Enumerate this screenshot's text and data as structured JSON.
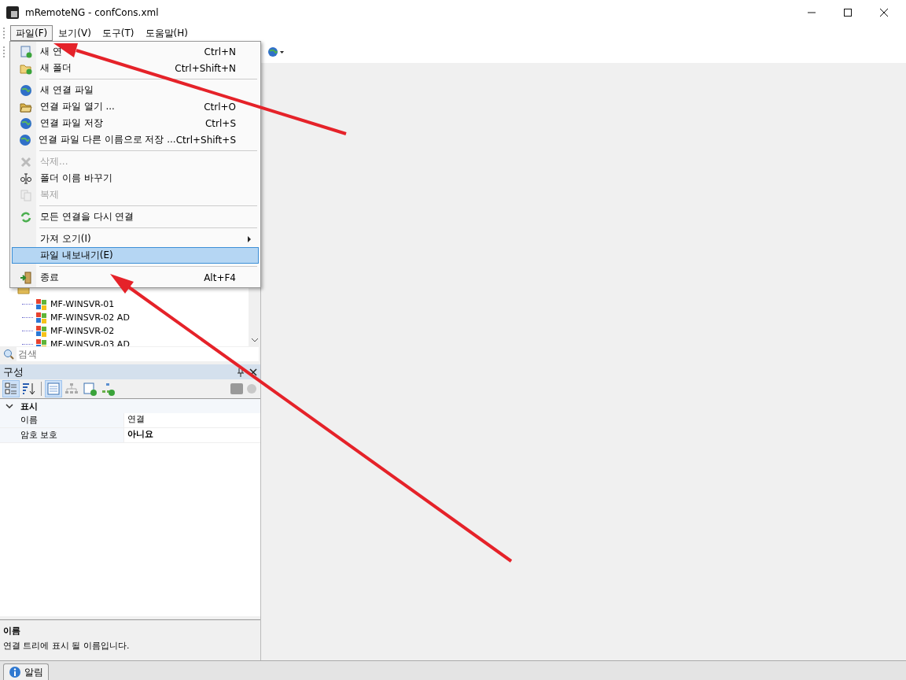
{
  "window": {
    "title": "mRemoteNG - confCons.xml"
  },
  "menubar": [
    {
      "label": "파일(F)",
      "selected": true
    },
    {
      "label": "보기(V)",
      "selected": false
    },
    {
      "label": "도구(T)",
      "selected": false
    },
    {
      "label": "도움말(H)",
      "selected": false
    }
  ],
  "file_menu": [
    {
      "kind": "item",
      "label": "새 연",
      "shortcut": "Ctrl+N",
      "disabled": false,
      "selected": false,
      "submenu": false
    },
    {
      "kind": "item",
      "label": "새 폴더",
      "shortcut": "Ctrl+Shift+N",
      "disabled": false,
      "selected": false,
      "submenu": false
    },
    {
      "kind": "separator"
    },
    {
      "kind": "item",
      "label": "새 연결 파일",
      "disabled": false,
      "selected": false,
      "submenu": false
    },
    {
      "kind": "item",
      "label": "연결 파일 열기 ...",
      "shortcut": "Ctrl+O",
      "disabled": false,
      "selected": false,
      "submenu": false
    },
    {
      "kind": "item",
      "label": "연결 파일 저장",
      "shortcut": "Ctrl+S",
      "disabled": false,
      "selected": false,
      "submenu": false
    },
    {
      "kind": "item",
      "label": "연결 파일 다른 이름으로 저장 ...",
      "shortcut": "Ctrl+Shift+S",
      "disabled": false,
      "selected": false,
      "submenu": false
    },
    {
      "kind": "separator"
    },
    {
      "kind": "item",
      "label": "삭제...",
      "disabled": true,
      "selected": false,
      "submenu": false
    },
    {
      "kind": "item",
      "label": "폴더 이름 바꾸기",
      "disabled": false,
      "selected": false,
      "submenu": false
    },
    {
      "kind": "item",
      "label": "복제",
      "disabled": true,
      "selected": false,
      "submenu": false
    },
    {
      "kind": "separator"
    },
    {
      "kind": "item",
      "label": "모든 연결을 다시 연결",
      "disabled": false,
      "selected": false,
      "submenu": false
    },
    {
      "kind": "separator"
    },
    {
      "kind": "item",
      "label": "가져 오기(I)",
      "disabled": false,
      "selected": false,
      "submenu": true
    },
    {
      "kind": "item",
      "label": "파일 내보내기(E)",
      "disabled": false,
      "selected": true,
      "submenu": false
    },
    {
      "kind": "separator"
    },
    {
      "kind": "item",
      "label": "종료",
      "shortcut": "Alt+F4",
      "disabled": false,
      "selected": false,
      "submenu": false
    }
  ],
  "tree": {
    "items": [
      {
        "label": "MF-WINSVR-01"
      },
      {
        "label": "MF-WINSVR-02 AD"
      },
      {
        "label": "MF-WINSVR-02"
      },
      {
        "label": "MF-WINSVR-03 AD"
      }
    ]
  },
  "search": {
    "placeholder": "검색"
  },
  "config_panel": {
    "title": "구성",
    "category": {
      "label": "표시",
      "expanded": true
    },
    "properties": [
      {
        "name": "이름",
        "value": "연결",
        "modified": false
      },
      {
        "name": "암호 보호",
        "value": "아니요",
        "modified": true
      }
    ],
    "description": {
      "title": "이름",
      "text": "연결 트리에 표시 될 이름입니다."
    }
  },
  "bottom_tabs": [
    {
      "label": "알림"
    }
  ]
}
